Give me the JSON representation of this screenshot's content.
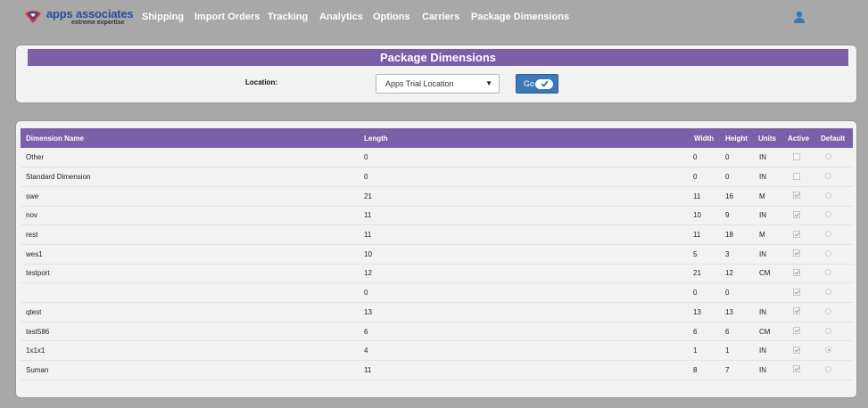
{
  "brand": {
    "name": "apps associates",
    "tagline": "extreme expertise"
  },
  "nav": [
    {
      "label": "Shipping"
    },
    {
      "label": "Import Orders"
    },
    {
      "label": "Tracking"
    },
    {
      "label": "Analytics"
    },
    {
      "label": "Options"
    },
    {
      "label": "Carriers"
    },
    {
      "label": "Package Dimensions"
    }
  ],
  "page": {
    "title": "Package Dimensions"
  },
  "filter": {
    "location_label": "Location:",
    "location_value": "Apps Trial Location",
    "go_label": "Go"
  },
  "table": {
    "headers": {
      "name": "Dimension Name",
      "length": "Length",
      "width": "Width",
      "height": "Height",
      "units": "Units",
      "active": "Active",
      "default": "Default"
    },
    "rows": [
      {
        "name": "Other",
        "length": "0",
        "width": "0",
        "height": "0",
        "units": "IN",
        "active": false,
        "default": false
      },
      {
        "name": "Standard Dimension",
        "length": "0",
        "width": "0",
        "height": "0",
        "units": "IN",
        "active": false,
        "default": false
      },
      {
        "name": "swe",
        "length": "21",
        "width": "11",
        "height": "16",
        "units": "M",
        "active": true,
        "default": false
      },
      {
        "name": "nov",
        "length": "11",
        "width": "10",
        "height": "9",
        "units": "IN",
        "active": true,
        "default": false
      },
      {
        "name": "rest",
        "length": "11",
        "width": "11",
        "height": "18",
        "units": "M",
        "active": true,
        "default": false
      },
      {
        "name": "wes1",
        "length": "10",
        "width": "5",
        "height": "3",
        "units": "IN",
        "active": true,
        "default": false
      },
      {
        "name": "testport",
        "length": "12",
        "width": "21",
        "height": "12",
        "units": "CM",
        "active": true,
        "default": false
      },
      {
        "name": "",
        "length": "0",
        "width": "0",
        "height": "0",
        "units": "",
        "active": true,
        "default": false
      },
      {
        "name": "qtest",
        "length": "13",
        "width": "13",
        "height": "13",
        "units": "IN",
        "active": true,
        "default": false
      },
      {
        "name": "test586",
        "length": "6",
        "width": "6",
        "height": "6",
        "units": "CM",
        "active": true,
        "default": false
      },
      {
        "name": "1x1x1",
        "length": "4",
        "width": "1",
        "height": "1",
        "units": "IN",
        "active": true,
        "default": true
      },
      {
        "name": "Suman",
        "length": "11",
        "width": "8",
        "height": "7",
        "units": "IN",
        "active": true,
        "default": false
      }
    ]
  },
  "colors": {
    "header_purple": "#7a60a8",
    "go_blue": "#3b78b5",
    "brand_blue": "#1f4f9c",
    "brand_red": "#d62f2f"
  },
  "icons": {
    "logo": "apps-associates-logo",
    "user": "user-icon",
    "go": "checkmark-icon",
    "select": "caret-down-icon"
  }
}
